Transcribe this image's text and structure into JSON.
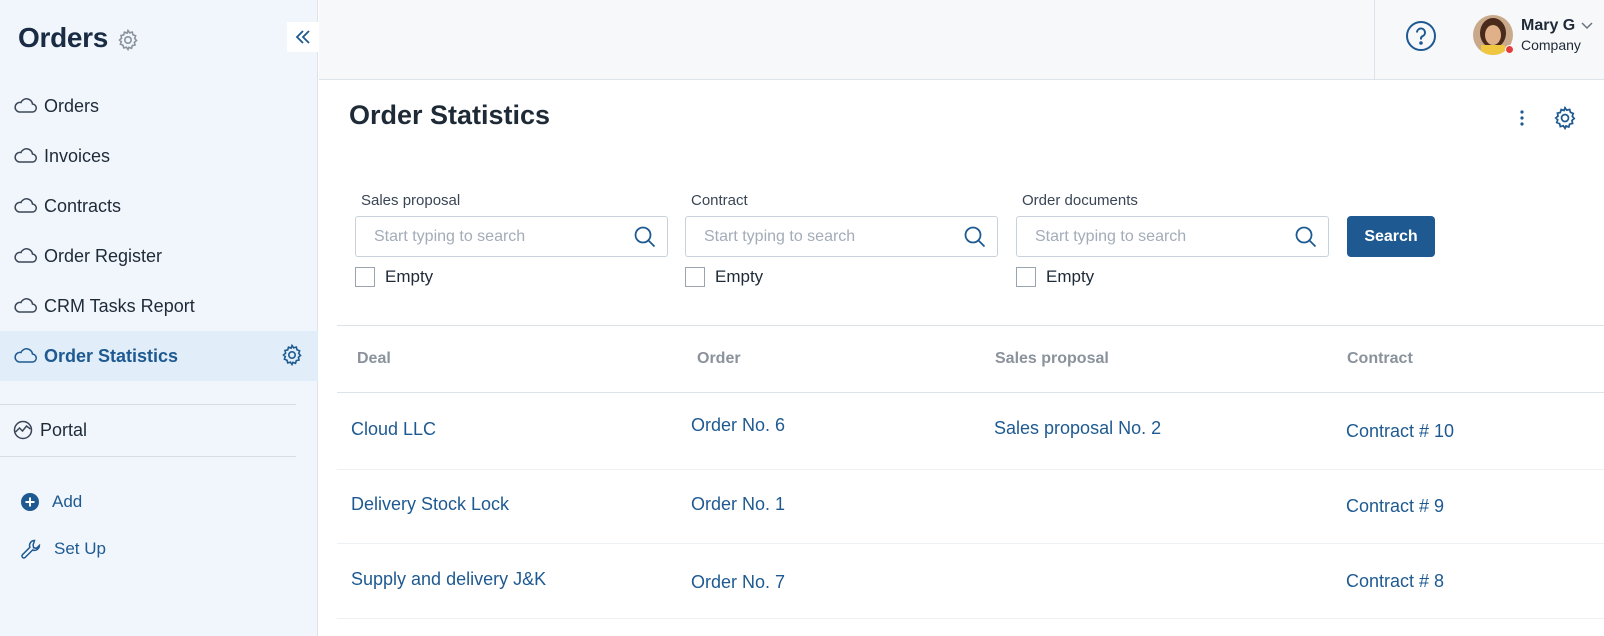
{
  "sidebar": {
    "title": "Orders",
    "items": [
      {
        "label": "Orders"
      },
      {
        "label": "Invoices"
      },
      {
        "label": "Contracts"
      },
      {
        "label": "Order Register"
      },
      {
        "label": "CRM Tasks Report"
      },
      {
        "label": "Order Statistics",
        "active": true
      }
    ],
    "portal": "Portal",
    "add_label": "Add",
    "setup_label": "Set Up"
  },
  "user": {
    "name": "Mary G",
    "company": "Company"
  },
  "page": {
    "title": "Order Statistics"
  },
  "filters": [
    {
      "label": "Sales proposal",
      "placeholder": "Start typing to search",
      "empty_label": "Empty"
    },
    {
      "label": "Contract",
      "placeholder": "Start typing to search",
      "empty_label": "Empty"
    },
    {
      "label": "Order documents",
      "placeholder": "Start typing to search",
      "empty_label": "Empty"
    }
  ],
  "search_button": "Search",
  "table": {
    "columns": [
      "Deal",
      "Order",
      "Sales proposal",
      "Contract"
    ],
    "rows": [
      {
        "deal": "Cloud LLC",
        "order": "Order No. 6",
        "proposal": "Sales proposal No. 2",
        "contract": "Contract # 10"
      },
      {
        "deal": "Delivery Stock Lock",
        "order": "Order No. 1",
        "proposal": "",
        "contract": "Contract # 9"
      },
      {
        "deal": "Supply and delivery J&K",
        "order": "Order No. 7",
        "proposal": "",
        "contract": "Contract # 8"
      }
    ]
  },
  "colors": {
    "accent": "#1e5a91",
    "sidebar_bg": "#f1f6fc",
    "active_bg": "#e1edf8",
    "status_dot": "#e63b3b"
  }
}
